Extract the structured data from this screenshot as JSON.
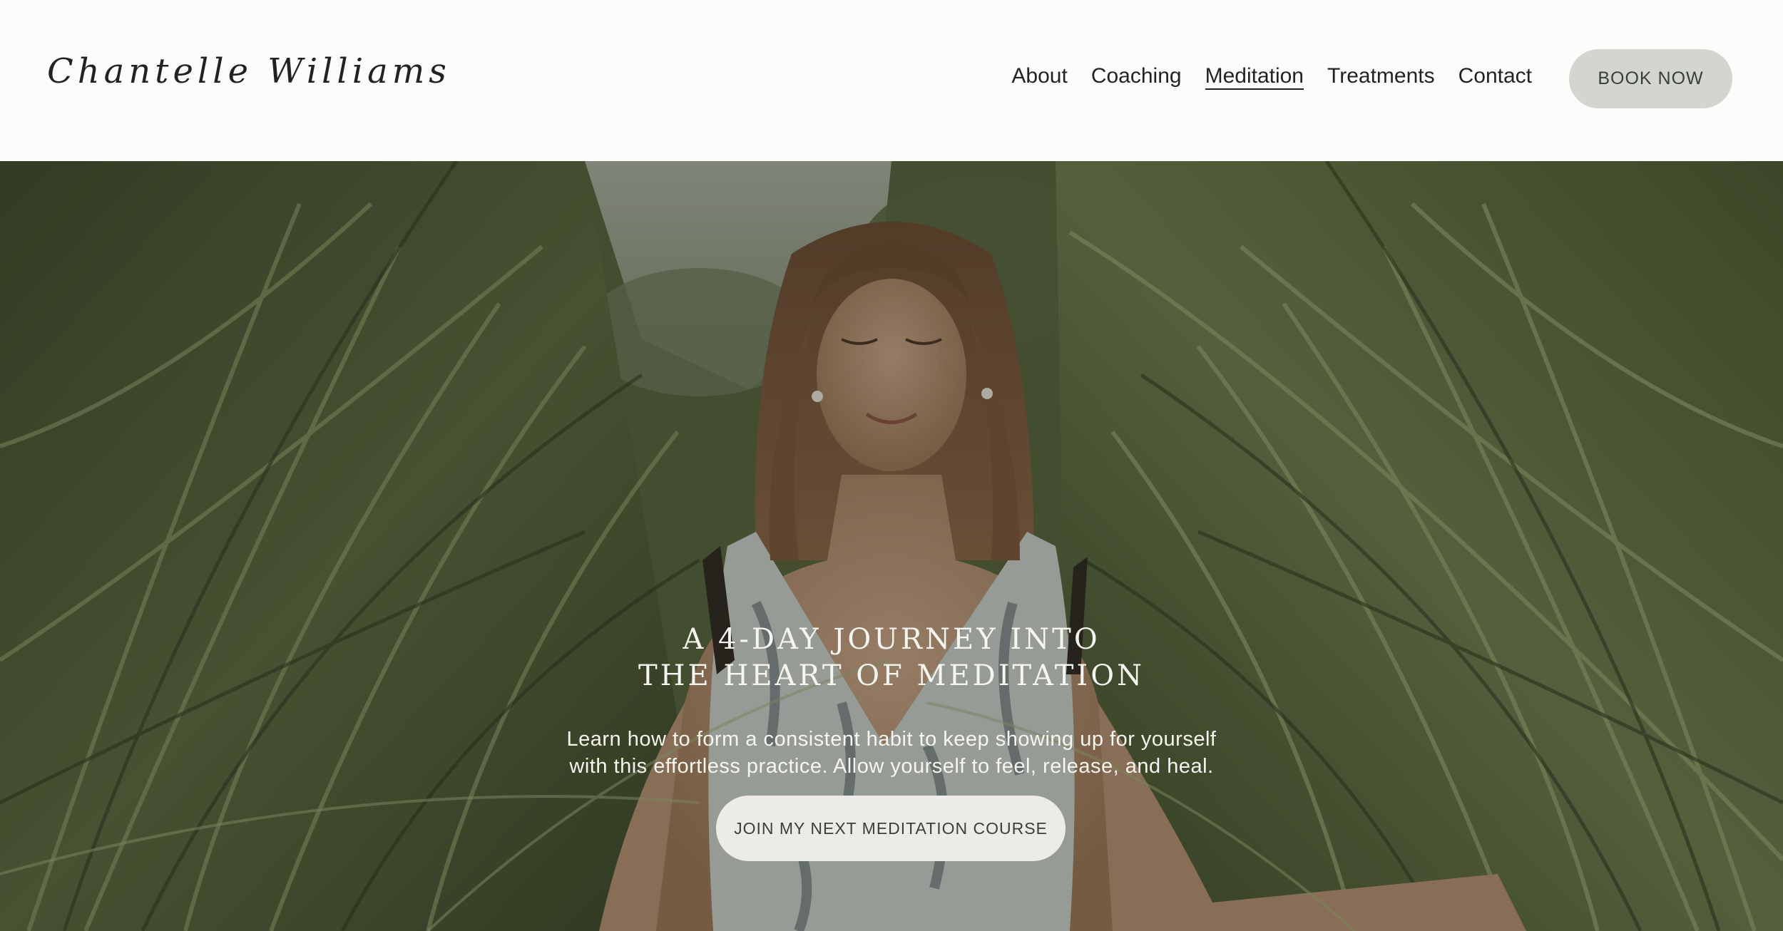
{
  "header": {
    "logo_text": "Chantelle Williams",
    "nav": [
      {
        "label": "About",
        "active": false
      },
      {
        "label": "Coaching",
        "active": false
      },
      {
        "label": "Meditation",
        "active": true
      },
      {
        "label": "Treatments",
        "active": false
      },
      {
        "label": "Contact",
        "active": false
      }
    ],
    "book_button": "BOOK NOW"
  },
  "hero": {
    "title_line1": "A 4-DAY JOURNEY INTO",
    "title_line2": "THE HEART OF MEDITATION",
    "subtitle_line1": "Learn how to form a consistent habit to keep showing up for yourself",
    "subtitle_line2": "with this effortless practice. Allow yourself to feel, release, and heal.",
    "cta_button": "JOIN MY NEXT MEDITATION COURSE",
    "background_image": "woman-meditating-in-tall-grass"
  },
  "colors": {
    "page_bg": "#fdfcfb",
    "text_dark": "#1f2321",
    "book_button_bg": "#d3d6d0",
    "cta_button_bg": "#ecebe8",
    "hero_text": "#f7f5f0"
  }
}
